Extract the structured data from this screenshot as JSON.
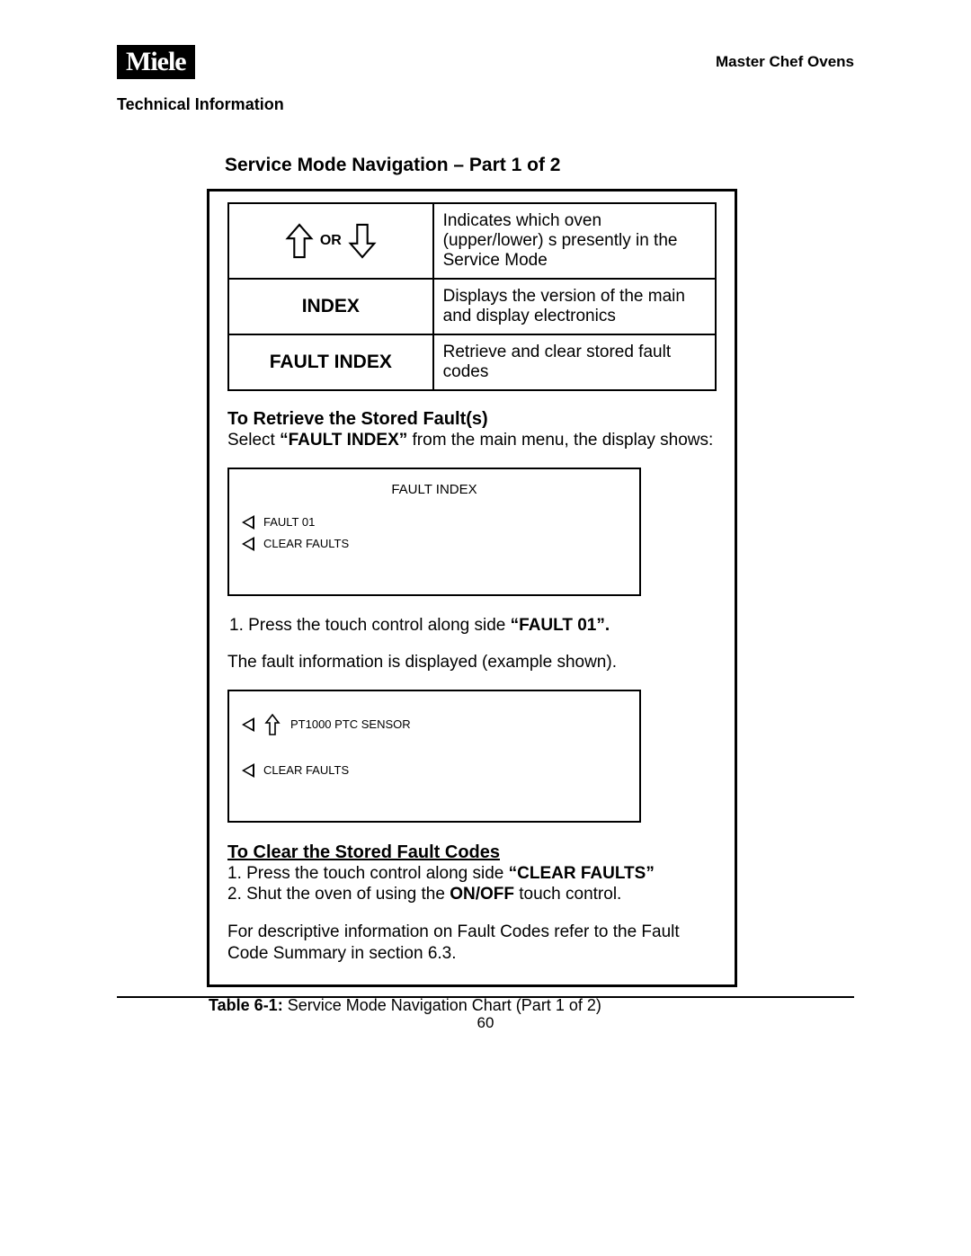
{
  "header": {
    "logo_text": "Miele",
    "right_text": "Master Chef Ovens",
    "subtitle": "Technical Information"
  },
  "section_title": "Service Mode Navigation – Part 1 of 2",
  "nav_table": {
    "rows": [
      {
        "left": "",
        "right": "Indicates which oven (upper/lower) s presently in the Service Mode",
        "arrows_or": "OR"
      },
      {
        "left": "INDEX",
        "right": "Displays the version of the main and display electronics"
      },
      {
        "left": "FAULT INDEX",
        "right": "Retrieve and clear stored fault codes"
      }
    ]
  },
  "retrieve": {
    "heading": "To Retrieve the Stored Fault(s)",
    "intro_prefix": "Select ",
    "intro_bold": "“FAULT INDEX”",
    "intro_suffix": " from the main menu, the display shows:",
    "display1": {
      "title": "FAULT INDEX",
      "row1": "FAULT 01",
      "row2": "CLEAR FAULTS"
    },
    "step1_prefix": "1.   Press the touch control along side ",
    "step1_bold": "“FAULT 01”.",
    "after_step1": "The fault information is displayed (example shown).",
    "display2": {
      "row1": "PT1000 PTC SENSOR",
      "row2": "CLEAR FAULTS"
    }
  },
  "clear": {
    "heading": "To Clear the Stored Fault Codes",
    "step1_prefix": "1.   Press the touch control along side ",
    "step1_bold": "“CLEAR FAULTS”",
    "step2_prefix": "2.   Shut the oven of using the ",
    "step2_bold": "ON/OFF",
    "step2_suffix": " touch control.",
    "note": "For descriptive information on Fault Codes refer to the Fault Code Summary in section 6.3."
  },
  "caption": {
    "label": "Table 6-1:",
    "text": " Service Mode Navigation Chart (Part 1 of 2)"
  },
  "page_number": "60"
}
